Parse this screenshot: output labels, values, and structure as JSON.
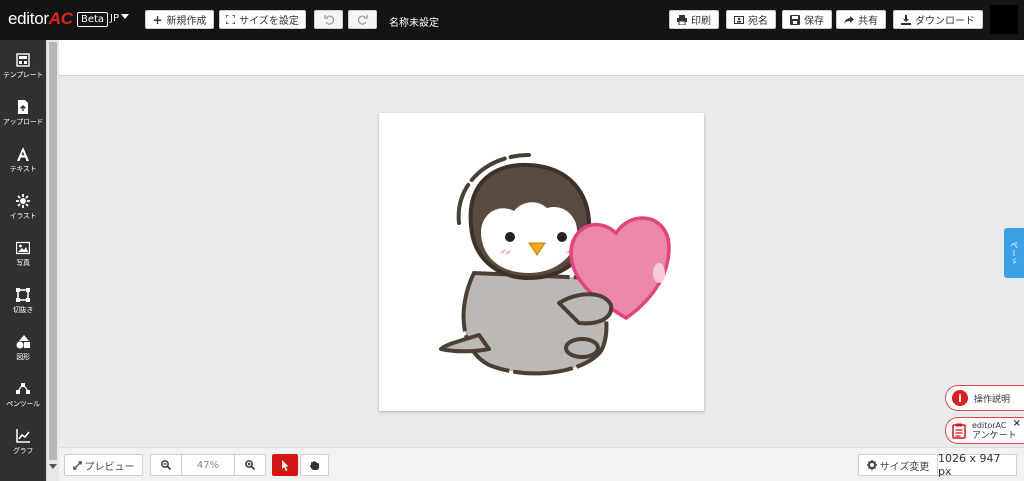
{
  "header": {
    "logo_text": "editor",
    "logo_accent": "AC",
    "beta_label": "Beta",
    "lang_label": "JP",
    "new_label": "新規作成",
    "size_label": "サイズを設定",
    "doc_name": "名称未設定",
    "print_label": "印刷",
    "address_label": "宛名",
    "save_label": "保存",
    "share_label": "共有",
    "download_label": "ダウンロード"
  },
  "sidebar": {
    "items": [
      {
        "label": "テンプレート",
        "icon": "template-icon"
      },
      {
        "label": "アップロード",
        "icon": "upload-icon"
      },
      {
        "label": "テキスト",
        "icon": "text-icon"
      },
      {
        "label": "イラスト",
        "icon": "illustration-icon"
      },
      {
        "label": "写真",
        "icon": "photo-icon"
      },
      {
        "label": "切抜き",
        "icon": "crop-icon"
      },
      {
        "label": "図形",
        "icon": "shapes-icon"
      },
      {
        "label": "ペンツール",
        "icon": "pen-tool-icon"
      },
      {
        "label": "グラフ",
        "icon": "chart-icon"
      }
    ]
  },
  "bottom": {
    "preview_label": "プレビュー",
    "zoom_value": "47%",
    "resize_label": "サイズ変更",
    "dimensions": "1026 x 947 px"
  },
  "floating": {
    "side_tab_label": "ぺーゞ",
    "help_label": "操作説明",
    "survey_line1": "editorAC",
    "survey_line2": "アンケート",
    "survey_close": "×"
  },
  "colors": {
    "accent": "#e0241b",
    "topbar": "#141414",
    "sidebar": "#2f3031",
    "side_tab": "#3aa0e8"
  }
}
